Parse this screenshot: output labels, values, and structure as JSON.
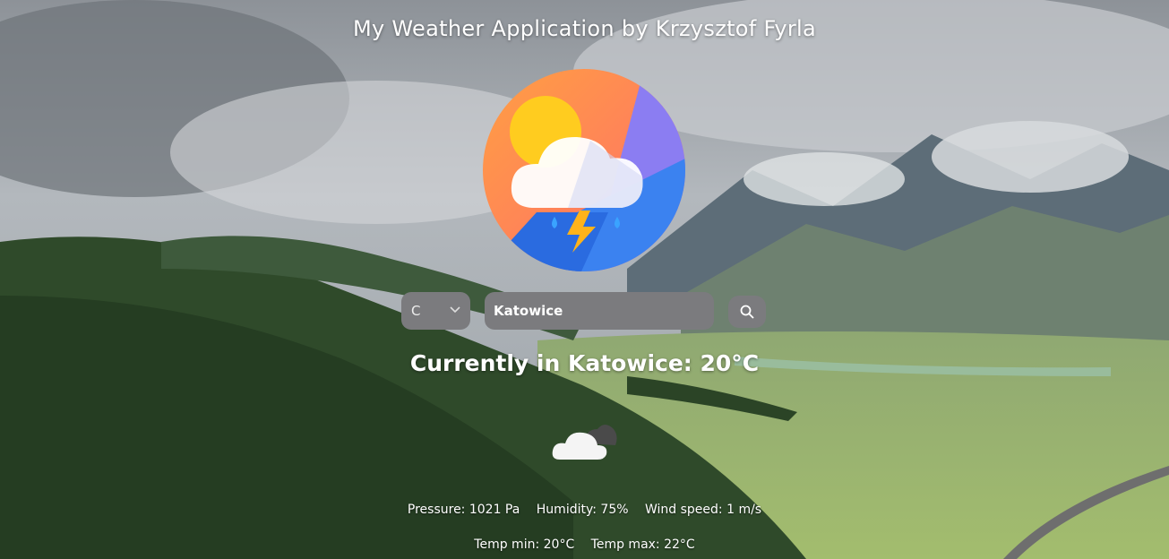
{
  "app": {
    "title": "My Weather Application by Krzysztof Fyrla"
  },
  "controls": {
    "unit_selected": "C",
    "city_value": "Katowice",
    "search_icon": "search-icon"
  },
  "current": {
    "text": "Currently in Katowice:  20°C",
    "icon": "cloudy-icon"
  },
  "details": {
    "pressure": "Pressure: 1021 Pa",
    "humidity": "Humidity: 75%",
    "wind": "Wind speed: 1 m/s",
    "temp_min": "Temp min: 20°C",
    "temp_max": "Temp max: 22°C"
  },
  "colors": {
    "control_bg": "#7b7b7e",
    "logo_orange": "#fba23c",
    "logo_purple": "#8a7cf0",
    "logo_blue": "#2f6fe0"
  }
}
